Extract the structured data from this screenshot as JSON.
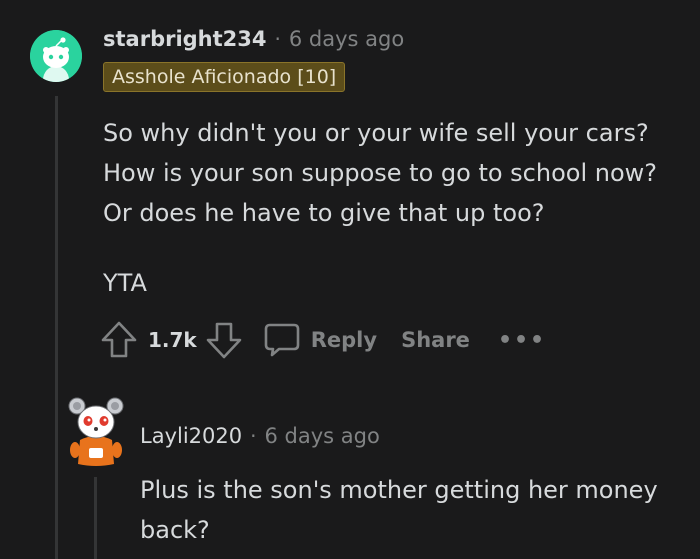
{
  "comment": {
    "username": "starbright234",
    "separator": "·",
    "timestamp": "6 days ago",
    "flair": "Asshole Aficionado [10]",
    "body": [
      "So why didn't you or your wife sell your cars? How is your son suppose to go to school now? Or does he have to give that up too?",
      "YTA"
    ],
    "actions": {
      "upvote_icon": "upvote-arrow-icon",
      "vote_count": "1.7k",
      "downvote_icon": "downvote-arrow-icon",
      "comment_icon": "speech-bubble-icon",
      "reply_label": "Reply",
      "share_label": "Share",
      "more_label": "•••"
    }
  },
  "reply": {
    "username": "Layli2020",
    "separator": "·",
    "timestamp": "6 days ago",
    "body": "Plus is the son's mother getting her money back?"
  },
  "colors": {
    "background": "#1a1a1b",
    "text": "#d7dadc",
    "muted": "#818384",
    "avatar_green": "#2ad39e",
    "flair_bg": "#5c4d1a"
  }
}
